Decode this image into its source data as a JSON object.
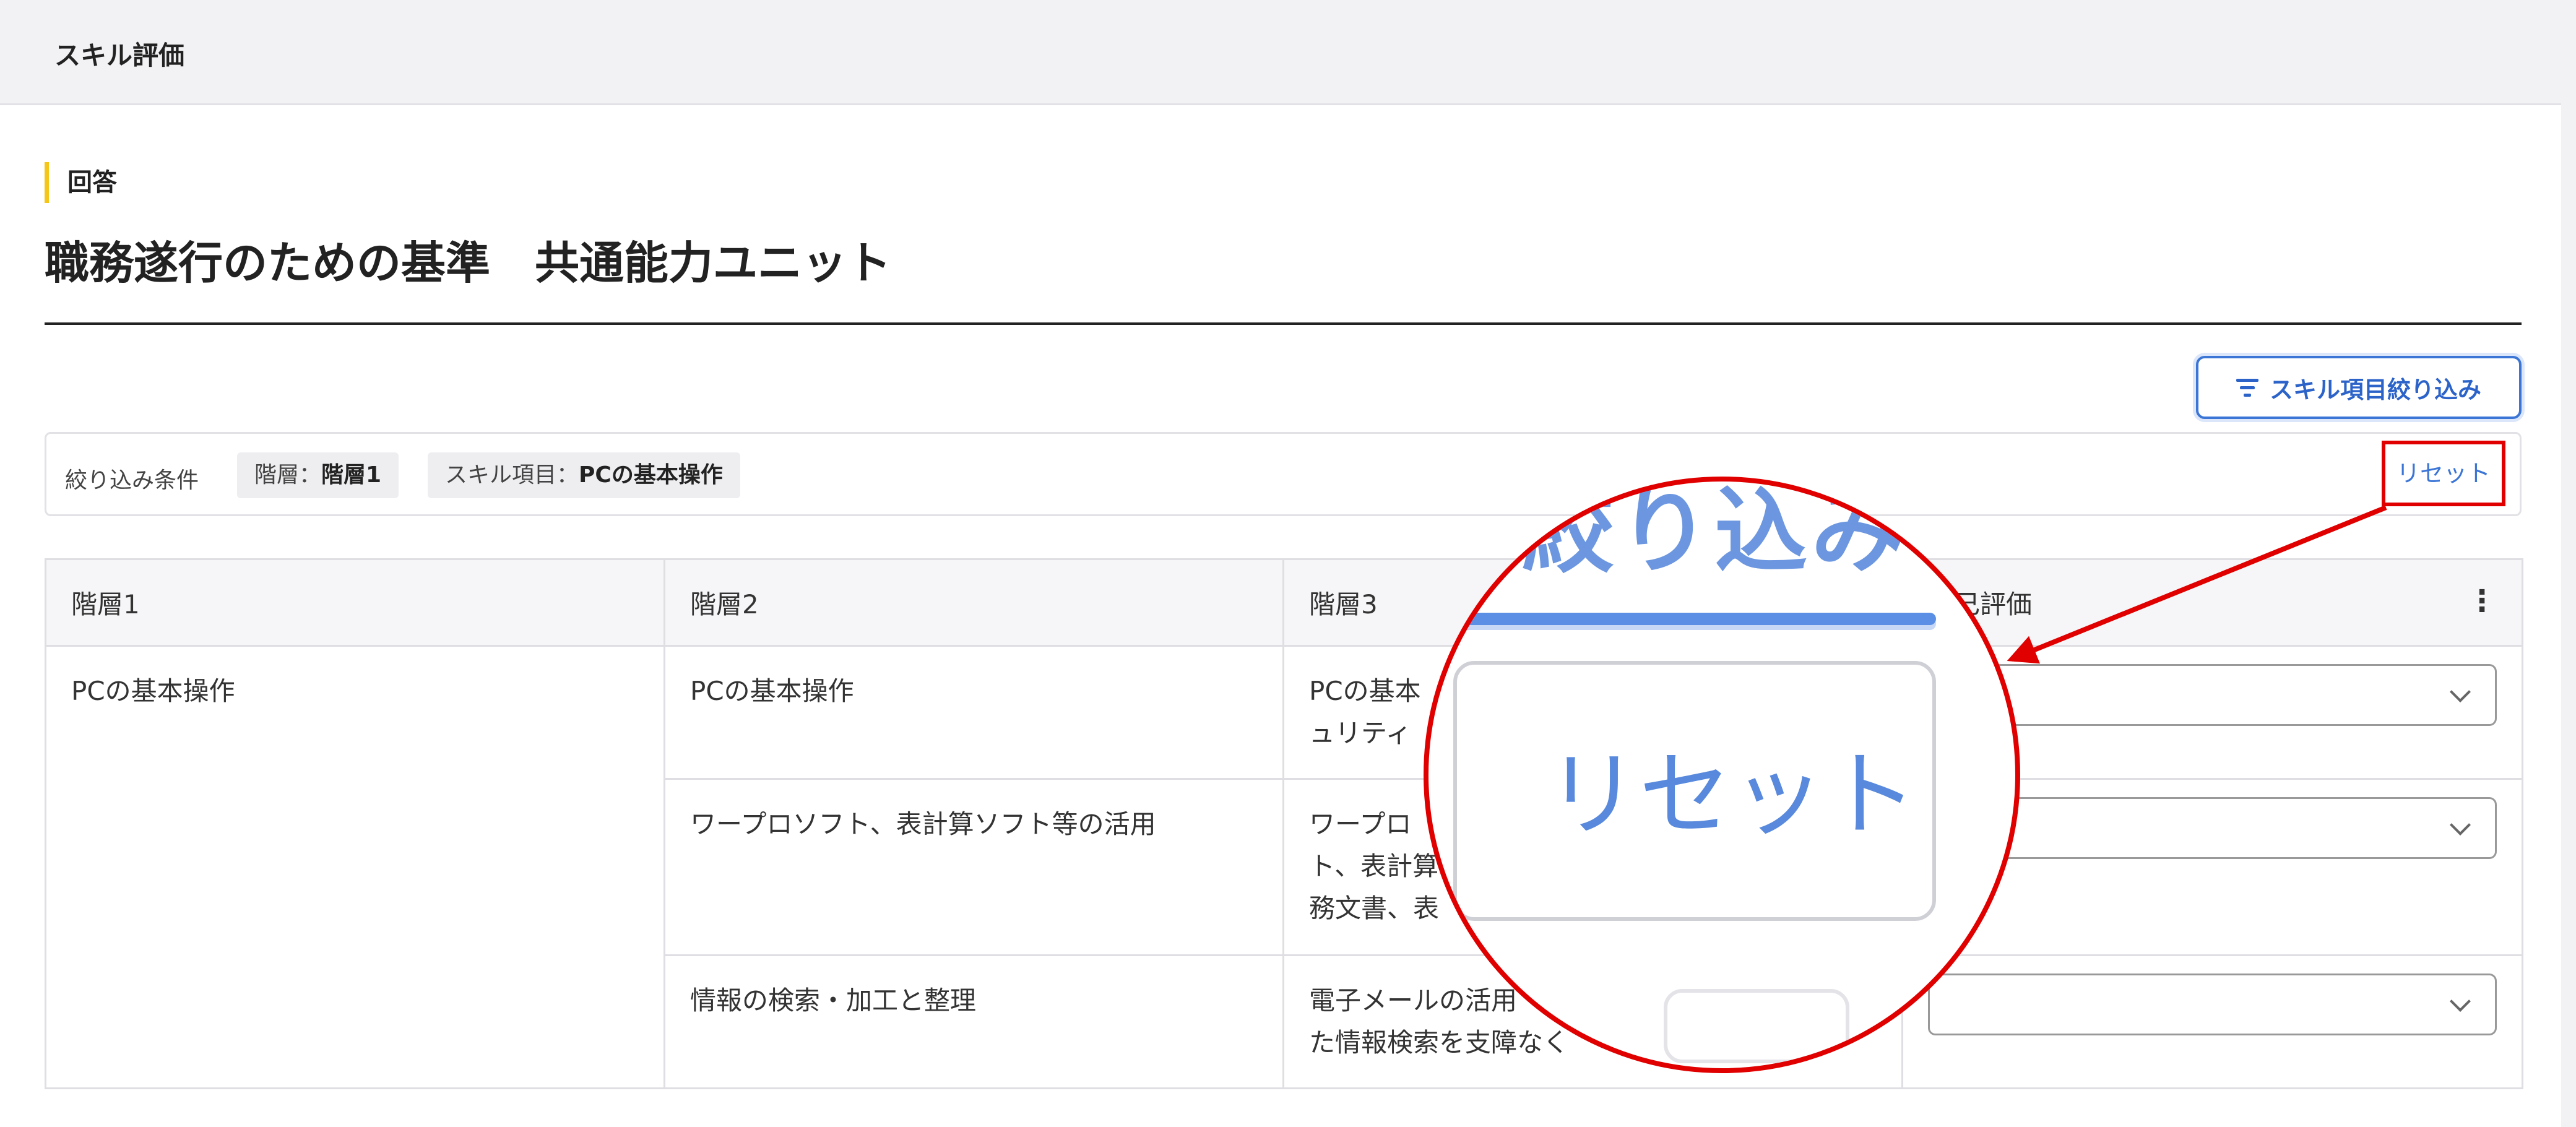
{
  "header": {
    "title": "スキル評価"
  },
  "section_label": "回答",
  "page_title": "職務遂行のための基準　共通能力ユニット",
  "filter_button": {
    "label": "スキル項目絞り込み",
    "icon": "filter-icon"
  },
  "filter_bar": {
    "label": "絞り込み条件",
    "chips": [
      {
        "key": "階層：",
        "value": "階層1"
      },
      {
        "key": "スキル項目：",
        "value": "PCの基本操作"
      }
    ],
    "reset_label": "リセット"
  },
  "table": {
    "headers": [
      "階層1",
      "階層2",
      "階層3",
      "自己評価"
    ],
    "kebab_icon": "⋮",
    "rows": [
      {
        "level1": "PCの基本操作",
        "level2": "PCの基本操作",
        "level3_lines": [
          "PCの基本",
          "ュリティ"
        ]
      },
      {
        "level1": "",
        "level2": "ワープロソフト、表計算ソフト等の活用",
        "level3_lines": [
          "ワープロ",
          "ト、表計算",
          "務文書、表"
        ]
      },
      {
        "level1": "",
        "level2": "情報の検索・加工と整理",
        "level3_lines": [
          "電子メールの活用",
          "た情報検索を支障なく"
        ]
      }
    ]
  },
  "magnifier": {
    "button_text": "絞り込み",
    "reset_text": "リセット"
  },
  "colors": {
    "accent": "#3b75d6",
    "highlight": "#e00000",
    "label_bar": "#f5c518"
  }
}
